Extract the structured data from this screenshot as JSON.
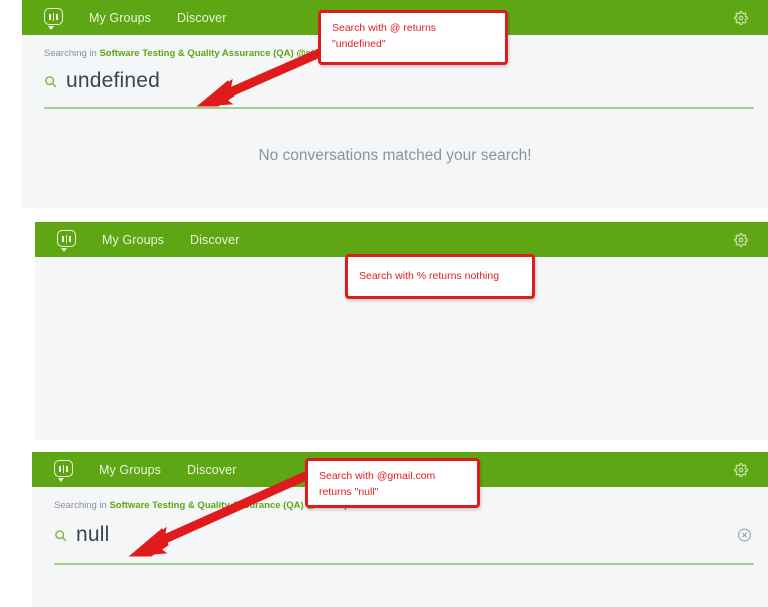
{
  "page": {
    "accent_green": "#5fa614",
    "annotation_red": "#e01b1b",
    "background": "#f4f6f8"
  },
  "nav": {
    "logo_name": "groups-logo",
    "my_groups": "My Groups",
    "discover": "Discover",
    "settings_icon": "gear-icon"
  },
  "panels": [
    {
      "id": "panel-undefined",
      "searching_in_prefix": "Searching in ",
      "searching_in_group": "Software Testing & Quality Assurance (QA) @standqa",
      "search_value": "undefined",
      "empty_message": "No conversations matched your search!",
      "has_clear_button": false,
      "callout": "Search with @ returns\n\"undefined\""
    },
    {
      "id": "panel-percent",
      "searching_in_prefix": "",
      "searching_in_group": "",
      "search_value": "",
      "empty_message": "",
      "has_clear_button": false,
      "callout": "Search with % returns nothing"
    },
    {
      "id": "panel-null",
      "searching_in_prefix": "Searching in ",
      "searching_in_group": "Software Testing & Quality Assurance (QA) @standqa",
      "search_value": "null",
      "empty_message": "",
      "has_clear_button": true,
      "clear_icon": "clear-search-icon",
      "callout": "Search with @gmail.com\nreturns \"null\""
    }
  ]
}
